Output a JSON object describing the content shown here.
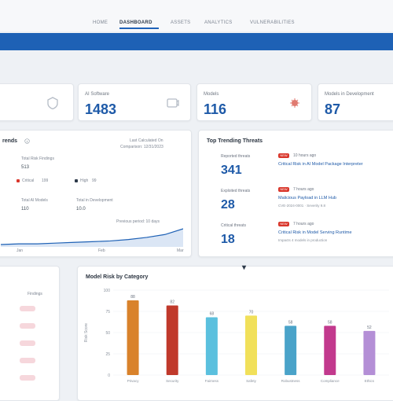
{
  "nav": {
    "items": [
      "HOME",
      "DASHBOARD",
      "ASSETS",
      "ANALYTICS",
      "VULNERABILITIES"
    ],
    "active_index": 1
  },
  "stats": [
    {
      "label": "",
      "value": "",
      "icon": "shield-icon"
    },
    {
      "label": "AI Software",
      "value": "1483",
      "icon": "cube-icon"
    },
    {
      "label": "Models",
      "value": "116",
      "icon": "bug-icon"
    },
    {
      "label": "Models in Development",
      "value": "87",
      "icon": ""
    }
  ],
  "overview": {
    "title": "rends",
    "info_icon": "info-icon",
    "caption_line1": "Last Calculated On",
    "caption_line2": "Comparison: 12/31/2023",
    "total_label": "Total Risk Findings",
    "total_value": "513",
    "legend": [
      {
        "label": "Critical",
        "value": "199",
        "color": "#d9362b"
      },
      {
        "label": "High",
        "value": "99",
        "color": "#2d3a4a"
      }
    ],
    "models_label": "Total AI Models",
    "models_value": "110",
    "dev_label": "Total in Development",
    "dev_value": "10.0",
    "trend_label": "Previous period: 10 days",
    "x_ticks": [
      "Jan",
      "Feb",
      "Mar"
    ],
    "trend_values": [
      8,
      9,
      9,
      10,
      11,
      12,
      13,
      15,
      18,
      22,
      30
    ]
  },
  "threats": {
    "title": "Top Trending Threats",
    "metrics": [
      {
        "label": "Reported threats",
        "value": "341"
      },
      {
        "label": "Exploited threats",
        "value": "28"
      },
      {
        "label": "Critical threats",
        "value": "18"
      }
    ],
    "items": [
      {
        "tag": "NEW",
        "time": "10 hours ago",
        "text": "Critical Risk in AI Model Package Interpreter",
        "sub": ""
      },
      {
        "tag": "NEW",
        "time": "7 hours ago",
        "text": "Malicious Payload in LLM Hub",
        "sub": "CVE-2024-0001 · Severity 9.8"
      },
      {
        "tag": "NEW",
        "time": "7 hours ago",
        "text": "Critical Risk in Model Serving Runtime",
        "sub": "Impacts 4 models in production"
      }
    ]
  },
  "left_panel": {
    "header": "Findings",
    "pill_count": 5
  },
  "category_chart": {
    "title": "Model Risk by Category",
    "ylabel": "Risk Score",
    "legend_icon": "triangle-icon"
  },
  "chart_data": {
    "type": "bar",
    "title": "Model Risk by Category",
    "ylabel": "Risk Score",
    "ylim": [
      0,
      100
    ],
    "y_ticks": [
      0,
      25,
      50,
      75,
      100
    ],
    "categories": [
      "Privacy",
      "Security",
      "Fairness",
      "Safety",
      "Robustness",
      "Compliance",
      "Ethics"
    ],
    "values": [
      88,
      82,
      68,
      70,
      58,
      58,
      52
    ],
    "colors": [
      "#d9822b",
      "#c0392b",
      "#5bc0de",
      "#f1e05a",
      "#4aa3c9",
      "#c2398d",
      "#b48fd6"
    ],
    "labels": [
      "88",
      "82",
      "68",
      "70",
      "58",
      "58",
      "52"
    ]
  }
}
